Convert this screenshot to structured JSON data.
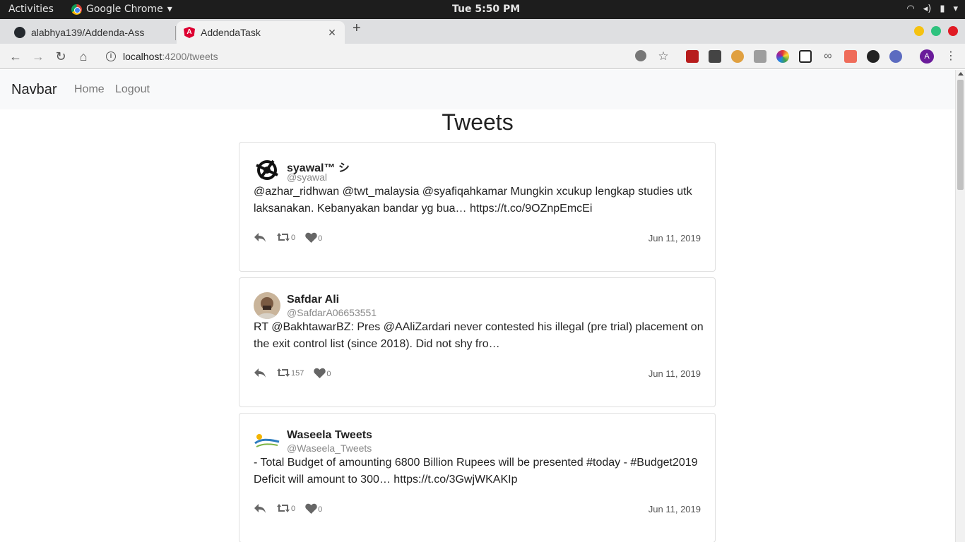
{
  "os": {
    "activities": "Activities",
    "app_name": "Google Chrome",
    "clock": "Tue  5:50 PM"
  },
  "browser": {
    "tabs": [
      {
        "title": "alabhya139/Addenda-Ass",
        "icon": "github-icon"
      },
      {
        "title": "AddendaTask",
        "icon": "angular-icon"
      }
    ],
    "url_host": "localhost",
    "url_path": ":4200/tweets",
    "profile_initial": "A",
    "window_colors": {
      "minimize": "#f5c211",
      "maximize": "#2ec27e",
      "close": "#e01b24"
    }
  },
  "navbar": {
    "brand": "Navbar",
    "links": [
      "Home",
      "Logout"
    ]
  },
  "page": {
    "title": "Tweets"
  },
  "tweets": [
    {
      "name": "syawal™ シ",
      "handle": "@syawal",
      "text": "@azhar_ridhwan @twt_malaysia @syafiqahkamar Mungkin xcukup lengkap studies utk laksanakan. Kebanyakan bandar yg bua… https://t.co/9OZnpEmcEi",
      "retweets": "0",
      "likes": "0",
      "date": "Jun 11, 2019",
      "avatar": "black-emblem-avatar"
    },
    {
      "name": "Safdar Ali",
      "handle": "@SafdarA06653551",
      "text": "RT @BakhtawarBZ: Pres @AAliZardari never contested his illegal (pre trial) placement on the exit control list (since 2018). Did not shy fro…",
      "retweets": "157",
      "likes": "0",
      "date": "Jun 11, 2019",
      "avatar": "photo-avatar"
    },
    {
      "name": "Waseela Tweets",
      "handle": "@Waseela_Tweets",
      "text": "- Total Budget of amounting 6800 Billion Rupees will be presented #today - #Budget2019 Deficit will amount to 300… https://t.co/3GwjWKAKIp",
      "retweets": "0",
      "likes": "0",
      "date": "Jun 11, 2019",
      "avatar": "waseela-logo-avatar"
    }
  ]
}
